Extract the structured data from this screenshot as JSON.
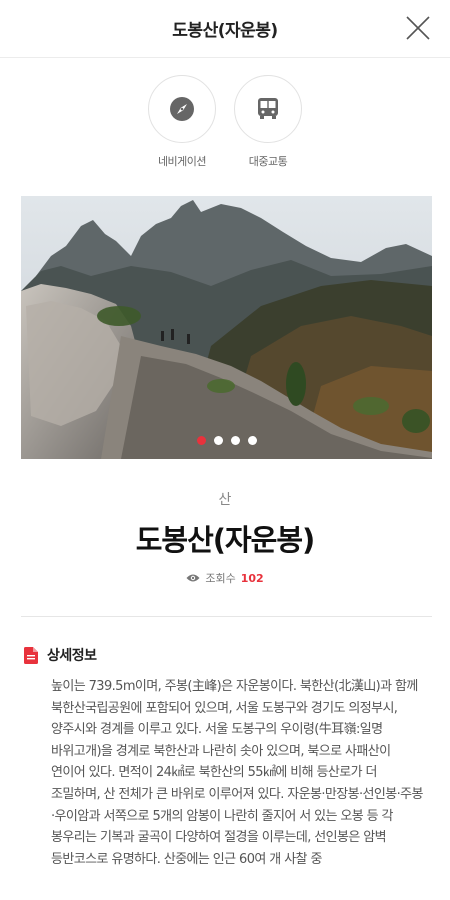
{
  "header": {
    "title": "도봉산(자운봉)",
    "close_icon": "close-icon"
  },
  "actions": {
    "navigation": {
      "label": "네비게이션",
      "icon": "compass-icon"
    },
    "transit": {
      "label": "대중교통",
      "icon": "bus-icon"
    }
  },
  "gallery": {
    "total": 4,
    "active_index": 0,
    "image": "mountain-photo"
  },
  "place": {
    "category": "산",
    "title": "도봉산(자운봉)",
    "views_label": "조회수",
    "views_count": "102"
  },
  "detail": {
    "title": "상세정보",
    "icon": "document-icon",
    "text": "높이는 739.5m이며, 주봉(主峰)은 자운봉이다. 북한산(北漢山)과 함께 북한산국립공원에 포함되어 있으며, 서울 도봉구와 경기도 의정부시, 양주시와 경계를 이루고 있다. 서울 도봉구의 우이령(牛耳嶺:일명 바위고개)을 경계로 북한산과 나란히 솟아 있으며, 북으로 사패산이 연이어 있다. 면적이 24㎢로 북한산의 55㎢에 비해 등산로가 더 조밀하며, 산 전체가 큰 바위로 이루어져 있다. 자운봉·만장봉·선인봉·주봉·우이암과 서쪽으로 5개의 암봉이 나란히 줄지어 서 있는 오봉 등 각 봉우리는 기복과 굴곡이 다양하여 절경을 이루는데, 선인봉은 암벽 등반코스로 유명하다. 산중에는 인근 60여 개 사찰 중"
  },
  "colors": {
    "accent": "#e8323c",
    "icon_gray": "#666666"
  }
}
